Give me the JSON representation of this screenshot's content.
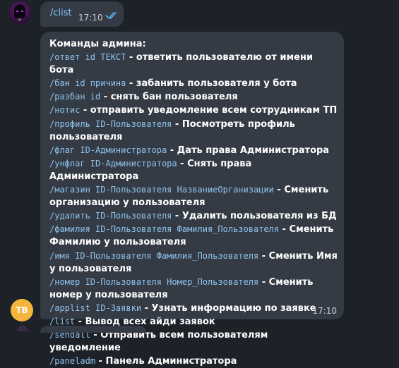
{
  "messages": {
    "top": {
      "text": "/clist",
      "time": "17:10",
      "read_status_icon": "double-check-icon"
    },
    "main": {
      "heading": "Команды админа:",
      "commands": [
        {
          "code": "/ответ id ТЕКСТ",
          "desc": " - ответить пользователю от имени бота"
        },
        {
          "code": "/бан id причина",
          "desc": " - забанить пользователя у бота"
        },
        {
          "code": "/разбан id",
          "desc": " - снять бан пользователя"
        },
        {
          "code": "/нотис",
          "desc": " - отправить уведомление всем сотрудникам ТП"
        },
        {
          "code": "/профиль ID-Пользователя",
          "desc": " - Посмотреть профиль пользователя"
        },
        {
          "code": "/флаг ID-Администратора",
          "desc": " - Дать права Администратора"
        },
        {
          "code": "/унфлаг ID-Администратора",
          "desc": " - Снять права Администратора"
        },
        {
          "code": "/магазин ID-Пользователя НазваниеОрганизации",
          "desc": " - Сменить организацию у пользователя"
        },
        {
          "code": "/удалить ID-Пользователя",
          "desc": " - Удалить пользователя из БД"
        },
        {
          "code": "/фамилия ID-Пользователя Фамилия_Пользователя",
          "desc": " - Сменить Фамилию у пользователя"
        },
        {
          "code": "/имя ID-Пользователя Фамилия_Пользователя",
          "desc": " - Сменить Имя у пользователя"
        },
        {
          "code": "/номер ID-Пользователя Номер_Пользователя",
          "desc": " - Сменить номер у пользователя"
        },
        {
          "code": "/applist ID-Заявки",
          "desc": " - Узнать информацию по заявке"
        },
        {
          "code": "/list",
          "desc": " - Вывод всех айди заявок"
        },
        {
          "code": "/sendall",
          "desc": " - Отправить всем пользователям уведомление"
        },
        {
          "code": "/paneladm",
          "desc": " - Панель Администратора"
        }
      ],
      "time": "17:10"
    }
  },
  "avatars": {
    "bot_initials": "TB",
    "bot_color": "#f5b43c"
  },
  "colors": {
    "background": "#1d2229",
    "bubble": "#353b45",
    "command_text": "#8fc3ee",
    "link_text": "#7fc8f8",
    "read_ticks": "#5fb0e8"
  }
}
